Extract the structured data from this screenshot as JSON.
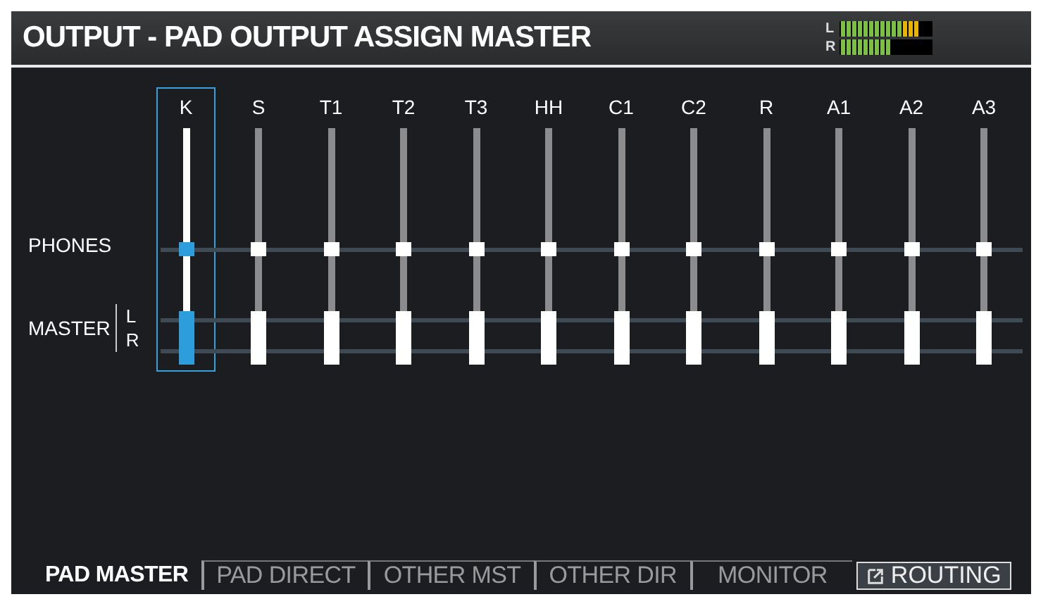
{
  "window": {
    "title": "OUTPUT - PAD OUTPUT ASSIGN MASTER"
  },
  "meter": [
    {
      "label": "L",
      "level": 0.85
    },
    {
      "label": "R",
      "level": 0.55
    }
  ],
  "row_labels": {
    "phones": "PHONES",
    "master": "MASTER",
    "left": "L",
    "right": "R"
  },
  "channels": [
    {
      "label": "K",
      "selected": true
    },
    {
      "label": "S",
      "selected": false
    },
    {
      "label": "T1",
      "selected": false
    },
    {
      "label": "T2",
      "selected": false
    },
    {
      "label": "T3",
      "selected": false
    },
    {
      "label": "HH",
      "selected": false
    },
    {
      "label": "C1",
      "selected": false
    },
    {
      "label": "C2",
      "selected": false
    },
    {
      "label": "R",
      "selected": false
    },
    {
      "label": "A1",
      "selected": false
    },
    {
      "label": "A2",
      "selected": false
    },
    {
      "label": "A3",
      "selected": false
    }
  ],
  "tabs": [
    {
      "label": "PAD MASTER",
      "selected": true
    },
    {
      "label": "PAD DIRECT",
      "selected": false
    },
    {
      "label": "OTHER MST",
      "selected": false
    },
    {
      "label": "OTHER DIR",
      "selected": false
    },
    {
      "label": "MONITOR",
      "selected": false
    }
  ],
  "routing_button": {
    "label": "ROUTING"
  }
}
